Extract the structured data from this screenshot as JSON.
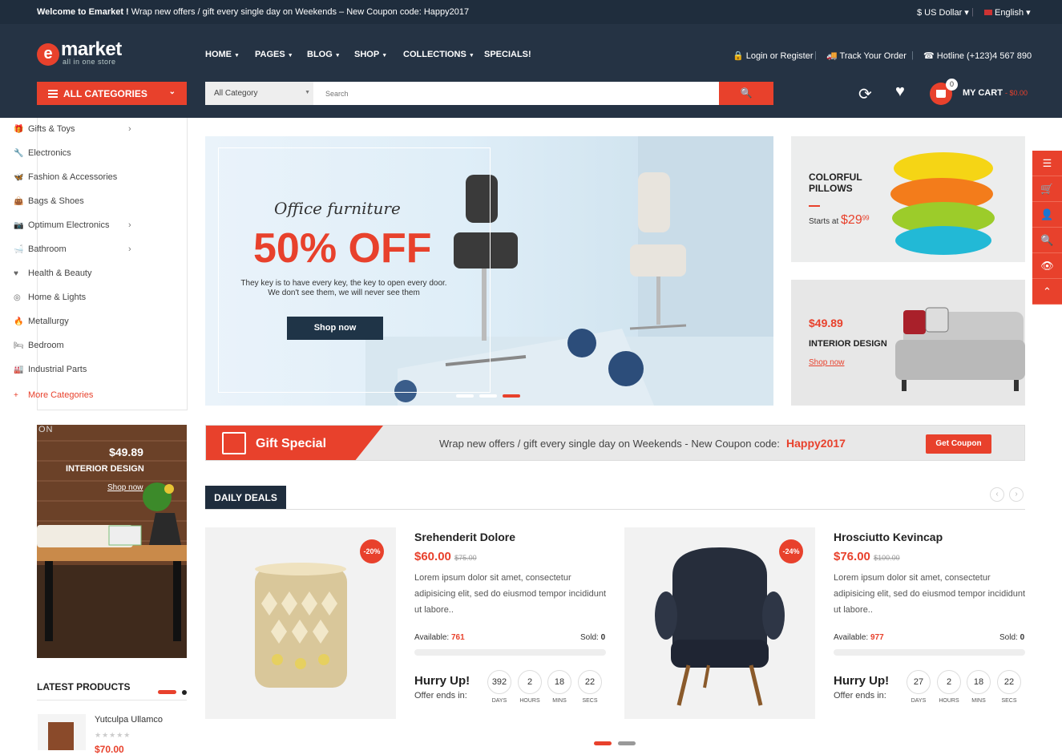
{
  "topbar": {
    "welcome_bold": "Welcome to Emarket !",
    "welcome_text": " Wrap new offers / gift every single day on Weekends – New Coupon code: Happy2017",
    "currency": "$ US Dollar ▾",
    "language": "English ▾"
  },
  "logo": {
    "letter": "e",
    "name": "market",
    "tagline": "all in one store"
  },
  "nav": [
    {
      "label": "HOME",
      "caret": "▼"
    },
    {
      "label": "PAGES",
      "caret": "▼"
    },
    {
      "label": "BLOG",
      "caret": "▼"
    },
    {
      "label": "SHOP",
      "caret": "▼"
    },
    {
      "label": "COLLECTIONS",
      "caret": "▼"
    },
    {
      "label": "SPECIALS!",
      "caret": ""
    }
  ],
  "header_links": {
    "login": "🔒 Login or Register",
    "track": "🚚 Track Your Order",
    "hotline": "☎ Hotline (+123)4 567 890"
  },
  "all_categories": {
    "label": "ALL CATEGORIES",
    "icon": "menu-icon",
    "caret": "⌄"
  },
  "search": {
    "category": "All Category",
    "placeholder": "Search",
    "button_icon": "search-icon",
    "button_glyph": "🔍"
  },
  "cart": {
    "count": "0",
    "label": "MY CART",
    "total": "- $0.00"
  },
  "categories": [
    {
      "label": "Gifts & Toys",
      "icon": "🎁",
      "arrow": "›"
    },
    {
      "label": "Electronics",
      "icon": "🔧",
      "arrow": ""
    },
    {
      "label": "Fashion & Accessories",
      "icon": "🦋",
      "arrow": ""
    },
    {
      "label": "Bags & Shoes",
      "icon": "👜",
      "arrow": ""
    },
    {
      "label": "Optimum Electronics",
      "icon": "📷",
      "arrow": "›"
    },
    {
      "label": "Bathroom",
      "icon": "🛁",
      "arrow": "›"
    },
    {
      "label": "Health & Beauty",
      "icon": "♥",
      "arrow": ""
    },
    {
      "label": "Home & Lights",
      "icon": "◎",
      "arrow": ""
    },
    {
      "label": "Metallurgy",
      "icon": "🔥",
      "arrow": ""
    },
    {
      "label": "Bedroom",
      "icon": "🛏",
      "arrow": ""
    },
    {
      "label": "Industrial Parts",
      "icon": "🏭",
      "arrow": ""
    }
  ],
  "more_categories": {
    "label": "More Categories",
    "icon": "+"
  },
  "hero": {
    "subtitle": "Office furniture",
    "headline": "50% OFF",
    "text1": "They key is to have every key, the key to open every door.",
    "text2": "We don't see them, we will never see them",
    "button": "Shop now"
  },
  "banner_pillows": {
    "title": "COLORFUL PILLOWS",
    "starts": "Starts at ",
    "price": "$29",
    "cents": "99"
  },
  "banner_sofa": {
    "price": "$49.89",
    "title": "INTERIOR DESIGN",
    "link": "Shop now"
  },
  "side_buttons": [
    "☰",
    "🛒",
    "👤",
    "🔍",
    "👁",
    "⌃"
  ],
  "left_banner": {
    "corner": "ON",
    "price": "$49.89",
    "title": "INTERIOR DESIGN",
    "link": "Shop now"
  },
  "latest": {
    "heading": "LATEST PRODUCTS",
    "item": {
      "name": "Yutculpa Ullamco",
      "stars": "★★★★★",
      "price": "$70.00"
    }
  },
  "gift": {
    "label": "Gift Special",
    "message": "Wrap new offers / gift every single day on Weekends - New Coupon code:",
    "code": "Happy2017",
    "button": "Get Coupon"
  },
  "deals": {
    "tab": "DAILY DEALS",
    "prev": "‹",
    "next": "›",
    "products": [
      {
        "name": "Srehenderit Dolore",
        "price": "$60.00",
        "old_price": "$75.00",
        "discount": "-20%",
        "desc": "Lorem ipsum dolor sit amet, consectetur adipisicing elit, sed do eiusmod tempor incididunt ut labore..",
        "available_label": "Available: ",
        "available": "761",
        "sold_label": "Sold: ",
        "sold": "0",
        "hurry": "Hurry Up!",
        "offer": "Offer ends in:",
        "countdown": [
          {
            "n": "392",
            "u": "DAYS"
          },
          {
            "n": "2",
            "u": "HOURS"
          },
          {
            "n": "18",
            "u": "MINS"
          },
          {
            "n": "22",
            "u": "SECS"
          }
        ]
      },
      {
        "name": "Hrosciutto Kevincap",
        "price": "$76.00",
        "old_price": "$100.00",
        "discount": "-24%",
        "desc": "Lorem ipsum dolor sit amet, consectetur adipisicing elit, sed do eiusmod tempor incididunt ut labore..",
        "available_label": "Available: ",
        "available": "977",
        "sold_label": "Sold: ",
        "sold": "0",
        "hurry": "Hurry Up!",
        "offer": "Offer ends in:",
        "countdown": [
          {
            "n": "27",
            "u": "DAYS"
          },
          {
            "n": "2",
            "u": "HOURS"
          },
          {
            "n": "18",
            "u": "MINS"
          },
          {
            "n": "22",
            "u": "SECS"
          }
        ]
      }
    ]
  },
  "colors": {
    "accent": "#e8412c",
    "header": "#253344",
    "topbar": "#1f2d3d"
  }
}
